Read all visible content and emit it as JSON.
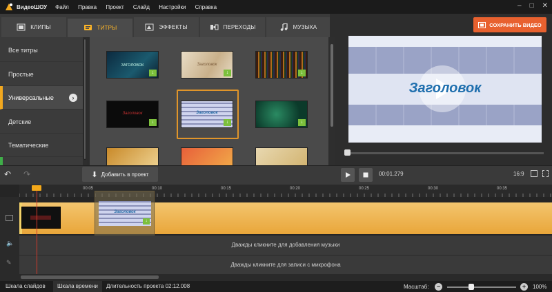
{
  "app": {
    "name": "ВидеоШОУ"
  },
  "menu": [
    "Файл",
    "Правка",
    "Проект",
    "Слайд",
    "Настройки",
    "Справка"
  ],
  "tabs": [
    {
      "label": "КЛИПЫ",
      "icon": "film-icon"
    },
    {
      "label": "ТИТРЫ",
      "icon": "titles-icon"
    },
    {
      "label": "ЭФФЕКТЫ",
      "icon": "effects-icon"
    },
    {
      "label": "ПЕРЕХОДЫ",
      "icon": "transitions-icon"
    },
    {
      "label": "МУЗЫКА",
      "icon": "music-icon"
    }
  ],
  "active_tab": "ТИТРЫ",
  "save_button": "СОХРАНИТЬ ВИДЕО",
  "categories": [
    "Все титры",
    "Простые",
    "Универсальные",
    "Детские",
    "Тематические"
  ],
  "active_category": "Универсальные",
  "thumbnails": [
    {
      "label": "ЗАГОЛОВОК"
    },
    {
      "label": "Заголовок"
    },
    {
      "label": ""
    },
    {
      "label": "Заголовок"
    },
    {
      "label": "Заголовок"
    },
    {
      "label": ""
    }
  ],
  "preview": {
    "title_text": "Заголовок"
  },
  "toolbar": {
    "add_to_project": "Добавить в проект"
  },
  "player": {
    "time": "00:01.279",
    "ratio": "16:9"
  },
  "timeline": {
    "ticks": [
      "00:05",
      "00:10",
      "00:15",
      "00:20",
      "00:25",
      "00:30",
      "00:35"
    ],
    "clip_label": "Заголовок",
    "music_hint": "Дважды кликните для добавления музыки",
    "mic_hint": "Дважды кликните для записи с микрофона"
  },
  "status": {
    "slides_tab": "Шкала слайдов",
    "timeline_tab": "Шкала времени",
    "duration": "Длительность проекта 02:12.008",
    "zoom_label": "Масштаб:",
    "zoom_value": "100%",
    "zoom_level": 0.35
  },
  "colors": {
    "accent": "#f2a81f",
    "save": "#e8612f",
    "download_badge": "#7cc03c"
  }
}
